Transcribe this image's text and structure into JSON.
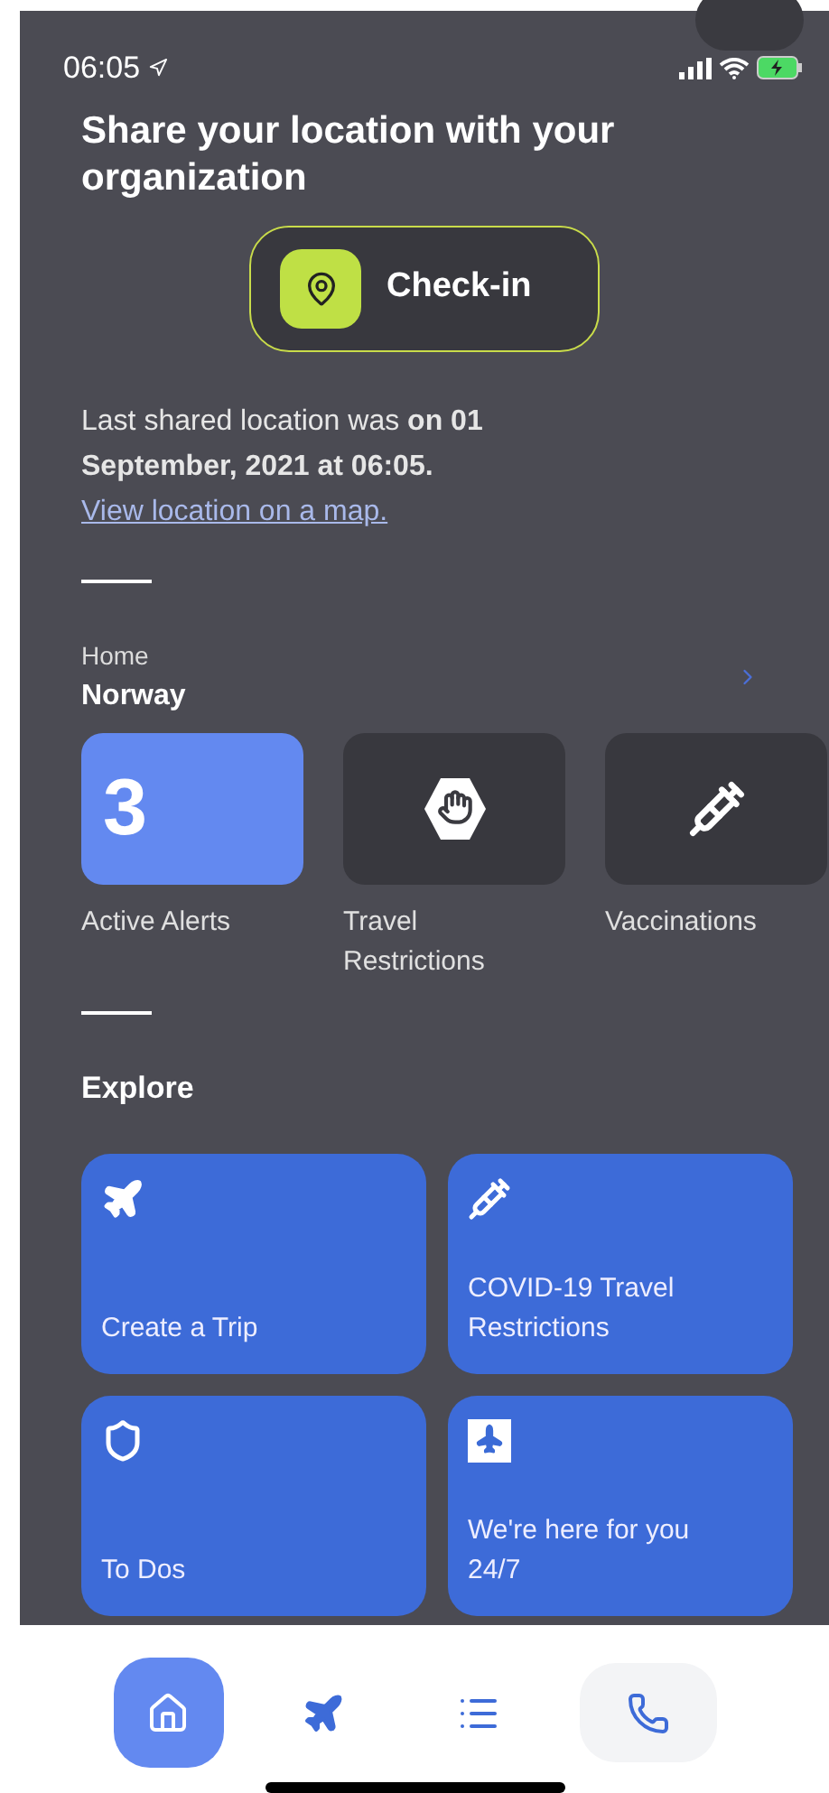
{
  "status_bar": {
    "time": "06:05"
  },
  "header": {
    "title": "Share your location  with your organization"
  },
  "check_in": {
    "label": "Check-in"
  },
  "last_shared": {
    "text": "Last shared location was **on 01 September, 2021 at 06:05.**",
    "link": "View location on a map."
  },
  "home": {
    "label": "Home",
    "country": "Norway"
  },
  "tiles": [
    {
      "kind": "count",
      "value": "3",
      "label": "Active Alerts"
    },
    {
      "kind": "icon",
      "label": "Travel Restrictions"
    },
    {
      "kind": "icon",
      "label": "Vaccinations"
    }
  ],
  "explore": {
    "title": "Explore",
    "cards": [
      {
        "label": "Create a Trip"
      },
      {
        "label": "COVID-19 Travel Restrictions"
      },
      {
        "label": "To Dos"
      },
      {
        "label": "We're here for you 24/7"
      }
    ]
  },
  "tab_bar": [
    {
      "selected": true
    },
    {
      "selected": false
    },
    {
      "selected": false
    },
    {
      "selected": false
    }
  ]
}
